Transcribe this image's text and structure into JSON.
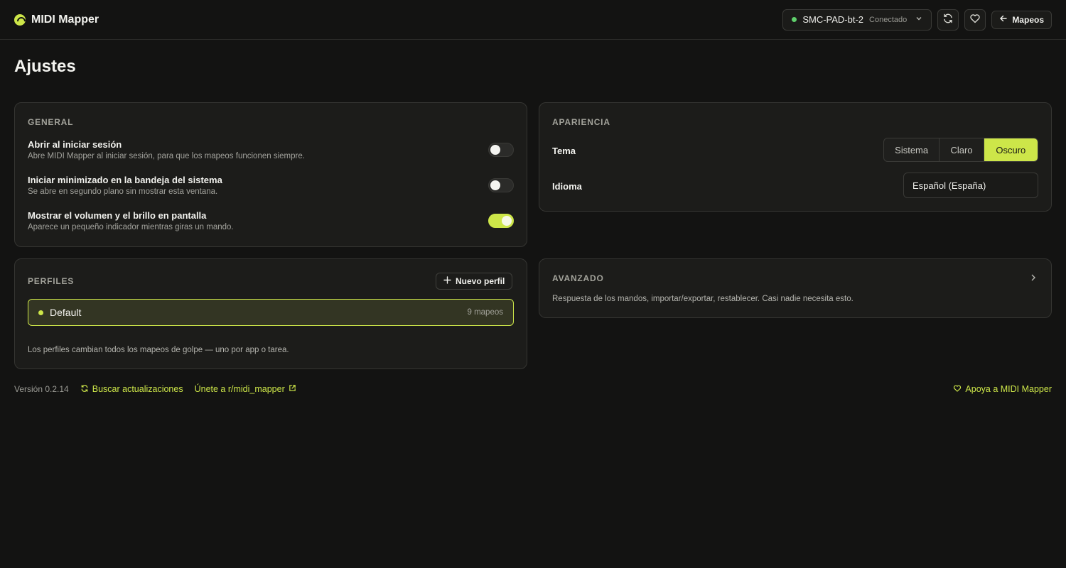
{
  "app": {
    "title": "MIDI Mapper"
  },
  "header": {
    "device_name": "SMC-PAD-bt-2",
    "device_status": "Conectado",
    "back_label": "Mapeos"
  },
  "page": {
    "title": "Ajustes"
  },
  "general": {
    "heading": "GENERAL",
    "settings": [
      {
        "title": "Abrir al iniciar sesión",
        "description": "Abre MIDI Mapper al iniciar sesión, para que los mapeos funcionen siempre.",
        "enabled": false
      },
      {
        "title": "Iniciar minimizado en la bandeja del sistema",
        "description": "Se abre en segundo plano sin mostrar esta ventana.",
        "enabled": false
      },
      {
        "title": "Mostrar el volumen y el brillo en pantalla",
        "description": "Aparece un pequeño indicador mientras giras un mando.",
        "enabled": true
      }
    ]
  },
  "appearance": {
    "heading": "APARIENCIA",
    "theme_label": "Tema",
    "theme_options": [
      "Sistema",
      "Claro",
      "Oscuro"
    ],
    "theme_selected": "Oscuro",
    "language_label": "Idioma",
    "language_value": "Español (España)"
  },
  "profiles": {
    "heading": "PERFILES",
    "new_button": "Nuevo perfil",
    "items": [
      {
        "name": "Default",
        "count": "9 mapeos"
      }
    ],
    "note": "Los perfiles cambian todos los mapeos de golpe — uno por app o tarea."
  },
  "advanced": {
    "heading": "AVANZADO",
    "description": "Respuesta de los mandos, importar/exportar, restablecer. Casi nadie necesita esto."
  },
  "footer": {
    "version": "Versión 0.2.14",
    "check_updates": "Buscar actualizaciones",
    "community": "Únete a r/midi_mapper",
    "support": "Apoya a MIDI Mapper"
  },
  "colors": {
    "accent": "#cde649",
    "background": "#131312",
    "card": "#1c1c1a",
    "status_connected": "#5fcf6b"
  }
}
